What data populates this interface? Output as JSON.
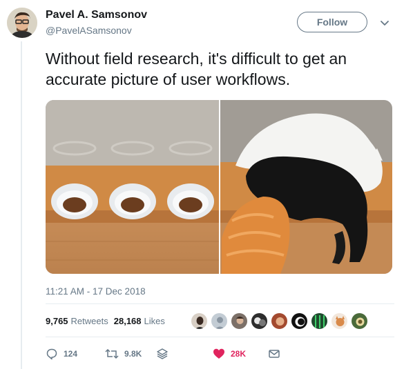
{
  "user": {
    "name": "Pavel A. Samsonov",
    "handle": "@PavelASamsonov"
  },
  "header": {
    "follow_label": "Follow"
  },
  "tweet": {
    "text": "Without field research, it's difficult to get an accurate picture of user workflows.",
    "timestamp": "11:21 AM - 17 Dec 2018"
  },
  "stats": {
    "retweets_count": "9,765",
    "retweets_label": "Retweets",
    "likes_count": "28,168",
    "likes_label": "Likes"
  },
  "actions": {
    "reply_count": "124",
    "retweet_count": "9.8K",
    "like_count": "28K"
  },
  "colors": {
    "text": "#14171a",
    "secondary": "#657786",
    "like": "#e0245e",
    "divider": "#e6ecf0"
  },
  "icons": [
    "reply-icon",
    "retweet-icon",
    "stack-icon",
    "heart-icon",
    "message-icon",
    "chevron-down-icon"
  ]
}
